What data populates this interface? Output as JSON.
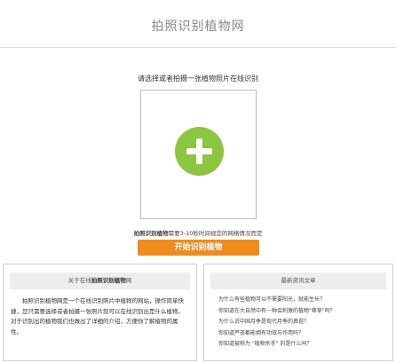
{
  "header": {
    "title": "拍照识别植物网"
  },
  "upload": {
    "prompt": "请选择或者拍摄一张植物照片在线识别",
    "add_icon": "plus-circle-icon",
    "note_bold": "拍照识别植物",
    "note_rest": "需要3-10秒时间视您的网络情况而定"
  },
  "start_button": {
    "label": "开始识别植物"
  },
  "about": {
    "title_prefix": "关于在线",
    "title_bold": "拍照识别植物",
    "title_suffix": "网",
    "body": "拍照识别植物网是一个在线识别照片中植物的网站，操作简单快捷，您只需要选择或者拍摄一张照片就可以在线识别出是什么植物。对于识别出的植物我们也做出了详细的介绍，方便你了解植物的属性。"
  },
  "news": {
    "title": "最新资讯文章",
    "items": [
      "为什么有些植物可以不需要阳光，就能生长？",
      "你知道在大自然中有一种会刺激的植物\"尊草\"吗？",
      "为什么说中国月季是现代月季的鼻祖？",
      "你知道芦荟都能拥有功效与作用吗？",
      "你知道被称为 \"植物杀手\" 的是什么吗？"
    ]
  },
  "colors": {
    "accent_green": "#8cc63f",
    "button_orange": "#f08c1e"
  }
}
